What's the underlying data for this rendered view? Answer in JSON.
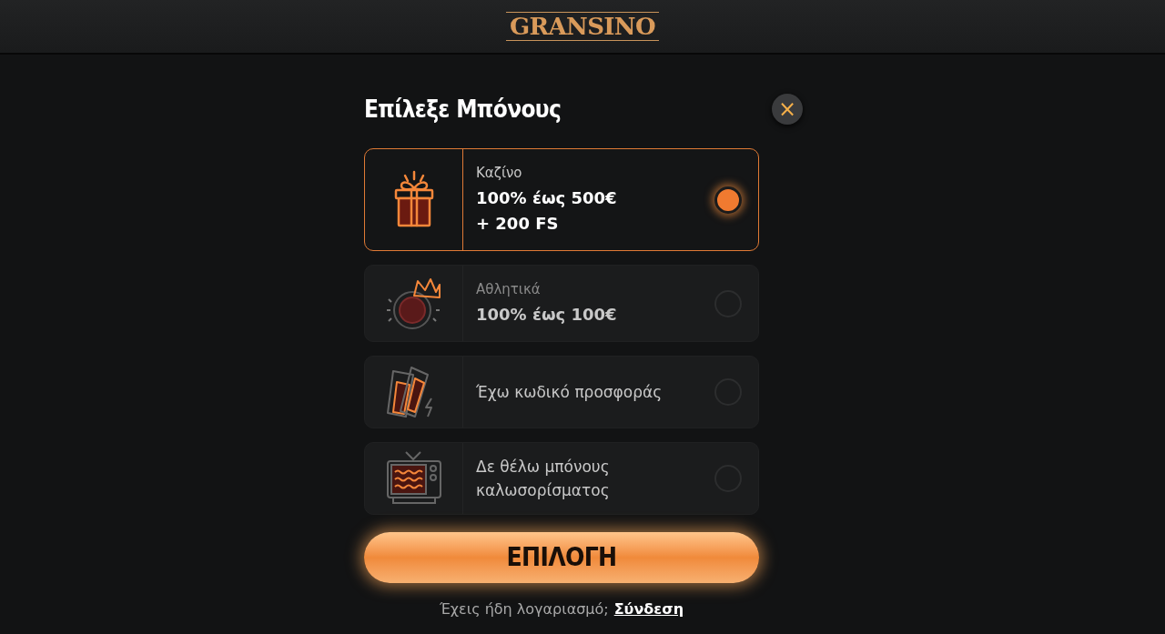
{
  "header": {
    "logo": "GRANSINO"
  },
  "dialog": {
    "title": "Επίλεξε Μπόνους",
    "close": "×",
    "options": [
      {
        "kind": "offer",
        "category": "Καζίνο",
        "amount": "100% έως 500€\n+ 200 FS",
        "selected": true
      },
      {
        "kind": "offer",
        "category": "Αθλητικά",
        "amount": "100% έως 100€",
        "selected": false
      },
      {
        "kind": "text",
        "text": "Έχω κωδικό προσφοράς",
        "selected": false
      },
      {
        "kind": "text",
        "text": "Δε θέλω μπόνους καλωσορίσματος",
        "selected": false
      }
    ],
    "button": "ΕΠΙΛΟΓΗ",
    "footer": {
      "text": "Έχεις ήδη λογαριασμό;",
      "link": "Σύνδεση"
    }
  }
}
